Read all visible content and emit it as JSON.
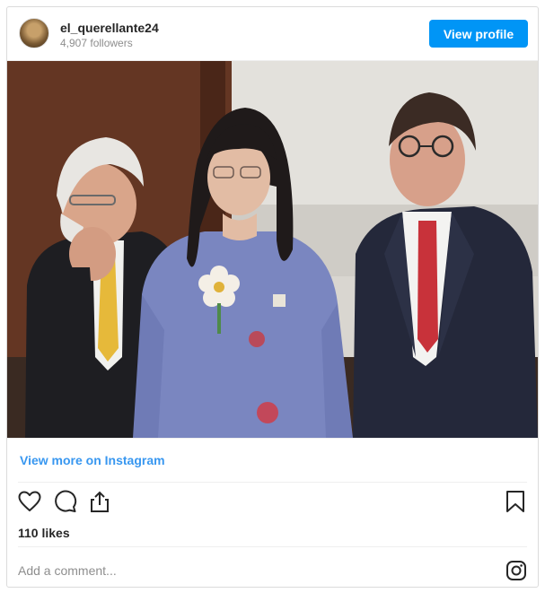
{
  "header": {
    "username": "el_querellante24",
    "followers": "4,907 followers",
    "view_profile_label": "View profile"
  },
  "post": {
    "view_more_label": "View more on Instagram",
    "likes": "110 likes"
  },
  "comment": {
    "placeholder": "Add a comment..."
  },
  "icons": {
    "like": "heart-icon",
    "comment": "comment-icon",
    "share": "share-icon",
    "save": "bookmark-icon",
    "brand": "instagram-icon"
  },
  "colors": {
    "accent": "#0095f6",
    "link": "#3897f0"
  }
}
